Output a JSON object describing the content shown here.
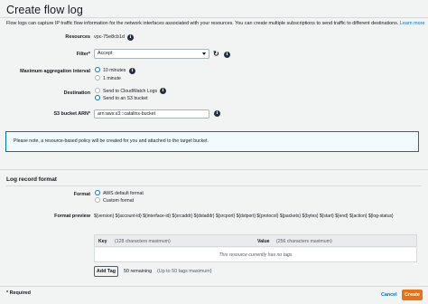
{
  "page": {
    "title": "Create flow log",
    "intro": "Flow logs can capture IP traffic flow information for the network interfaces associated with your resources. You can create multiple subscriptions to send traffic to different destinations.",
    "learn_more": "Learn more"
  },
  "form": {
    "resources": {
      "label": "Resources",
      "value": "vpc-75e8cb1d"
    },
    "filter": {
      "label": "Filter*",
      "selected": "Accept"
    },
    "aggregation": {
      "label": "Maximum aggregation interval",
      "options": [
        "10 minutes",
        "1 minute"
      ],
      "selected": "10 minutes"
    },
    "destination": {
      "label": "Destination",
      "options": [
        "Send to CloudWatch Logs",
        "Send to an S3 bucket"
      ],
      "selected": "Send to an S3 bucket"
    },
    "s3_arn": {
      "label": "S3 bucket ARN*",
      "value": "arn:aws:s3:::catalins-bucket"
    }
  },
  "notice": "Please note, a resource-based policy will be created for you and attached to the target bucket.",
  "log_format": {
    "section_title": "Log record format",
    "format_label": "Format",
    "format_options": [
      "AWS default format",
      "Custom format"
    ],
    "format_selected": "AWS default format",
    "preview_label": "Format preview",
    "preview_value": "${version} ${account-id} ${interface-id} ${srcaddr} ${dstaddr} ${srcport} ${dstport} ${protocol} ${packets} ${bytes} ${start} ${end} ${action} ${log-status}"
  },
  "tags": {
    "key_header": "Key",
    "key_hint": "(128 characters maximum)",
    "value_header": "Value",
    "value_hint": "(256 characters maximum)",
    "empty_text": "This resource currently has no tags",
    "add_tag": "Add Tag",
    "remaining": "50 remaining",
    "remaining_hint": "(Up to 50 tags maximum)"
  },
  "footer": {
    "required_note": "* Required",
    "cancel": "Cancel",
    "create": "Create"
  },
  "colors": {
    "accent": "#0073bb",
    "primary_button": "#ec7211",
    "notice_bg": "#f1faff"
  }
}
